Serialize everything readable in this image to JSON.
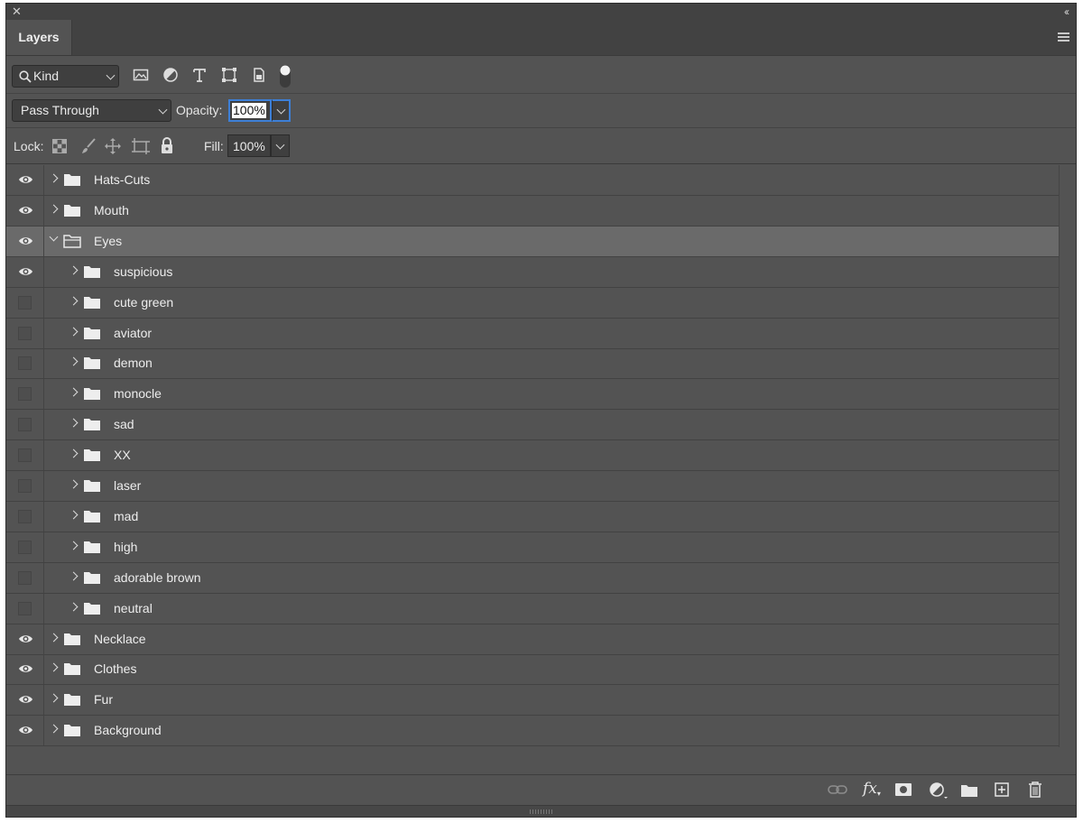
{
  "panel": {
    "tab_label": "Layers"
  },
  "filter": {
    "kind_label": "Kind",
    "icons": [
      "image-filter-icon",
      "adjustment-filter-icon",
      "type-filter-icon",
      "shape-filter-icon",
      "smart-object-filter-icon",
      "filter-toggle-icon"
    ]
  },
  "blend": {
    "mode": "Pass Through",
    "opacity_label": "Opacity:",
    "opacity_value": "100%"
  },
  "lock": {
    "label": "Lock:",
    "icons": [
      "lock-transparent-icon",
      "lock-paint-icon",
      "lock-position-icon",
      "lock-artboard-icon",
      "lock-all-icon"
    ],
    "fill_label": "Fill:",
    "fill_value": "100%"
  },
  "layers": [
    {
      "name": "Hats-Cuts",
      "visible": true,
      "indent": 0,
      "expanded": false,
      "selected": false
    },
    {
      "name": "Mouth",
      "visible": true,
      "indent": 0,
      "expanded": false,
      "selected": false
    },
    {
      "name": "Eyes",
      "visible": true,
      "indent": 0,
      "expanded": true,
      "selected": true
    },
    {
      "name": "suspicious",
      "visible": true,
      "indent": 1,
      "expanded": false,
      "selected": false
    },
    {
      "name": "cute green",
      "visible": false,
      "indent": 1,
      "expanded": false,
      "selected": false
    },
    {
      "name": "aviator",
      "visible": false,
      "indent": 1,
      "expanded": false,
      "selected": false
    },
    {
      "name": "demon",
      "visible": false,
      "indent": 1,
      "expanded": false,
      "selected": false
    },
    {
      "name": "monocle",
      "visible": false,
      "indent": 1,
      "expanded": false,
      "selected": false
    },
    {
      "name": "sad",
      "visible": false,
      "indent": 1,
      "expanded": false,
      "selected": false
    },
    {
      "name": "XX",
      "visible": false,
      "indent": 1,
      "expanded": false,
      "selected": false
    },
    {
      "name": "laser",
      "visible": false,
      "indent": 1,
      "expanded": false,
      "selected": false
    },
    {
      "name": "mad",
      "visible": false,
      "indent": 1,
      "expanded": false,
      "selected": false
    },
    {
      "name": "high",
      "visible": false,
      "indent": 1,
      "expanded": false,
      "selected": false
    },
    {
      "name": "adorable brown",
      "visible": false,
      "indent": 1,
      "expanded": false,
      "selected": false
    },
    {
      "name": "neutral",
      "visible": false,
      "indent": 1,
      "expanded": false,
      "selected": false
    },
    {
      "name": "Necklace",
      "visible": true,
      "indent": 0,
      "expanded": false,
      "selected": false
    },
    {
      "name": "Clothes",
      "visible": true,
      "indent": 0,
      "expanded": false,
      "selected": false
    },
    {
      "name": "Fur",
      "visible": true,
      "indent": 0,
      "expanded": false,
      "selected": false
    },
    {
      "name": "Background",
      "visible": true,
      "indent": 0,
      "expanded": false,
      "selected": false
    }
  ],
  "footer": {
    "icons": [
      "link-layers-icon",
      "fx-icon",
      "layer-mask-icon",
      "adjustment-layer-icon",
      "new-group-icon",
      "new-layer-icon",
      "trash-icon"
    ],
    "fx_text": "fx"
  },
  "colors": {
    "panel_bg": "#535353",
    "selected_row": "#6a6a6a",
    "focus_ring": "#4a8fe0"
  }
}
